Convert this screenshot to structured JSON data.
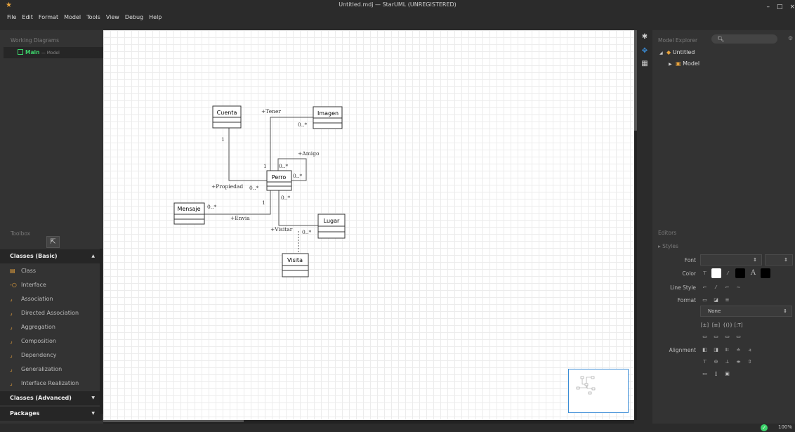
{
  "window": {
    "title": "Untitled.mdj — StarUML (UNREGISTERED)"
  },
  "menu": [
    "File",
    "Edit",
    "Format",
    "Model",
    "Tools",
    "View",
    "Debug",
    "Help"
  ],
  "working_diagrams": {
    "title": "Working Diagrams",
    "items": [
      {
        "name": "Main",
        "sub": "— Model"
      }
    ]
  },
  "toolbox": {
    "title": "Toolbox",
    "pointer": "⇱",
    "sections": [
      {
        "label": "Classes (Basic)",
        "expanded": true
      },
      {
        "label": "Classes (Advanced)",
        "expanded": false
      },
      {
        "label": "Packages",
        "expanded": false
      }
    ],
    "tools": [
      "Class",
      "Interface",
      "Association",
      "Directed Association",
      "Aggregation",
      "Composition",
      "Dependency",
      "Generalization",
      "Interface Realization"
    ]
  },
  "model_explorer": {
    "title": "Model Explorer",
    "search_placeholder": "",
    "tree": [
      {
        "label": "Untitled"
      },
      {
        "label": "Model"
      }
    ]
  },
  "editors": {
    "title": "Editors",
    "styles_label": "Styles",
    "labels": {
      "font": "Font",
      "color": "Color",
      "line_style": "Line Style",
      "format": "Format",
      "alignment": "Alignment"
    },
    "format_select": "None"
  },
  "diagram": {
    "classes": [
      "Cuenta",
      "Imagen",
      "Perro",
      "Mensaje",
      "Lugar",
      "Visita"
    ],
    "labels": {
      "tener": "+Tener",
      "tener_mult": "0..*",
      "cuenta_mult": "1",
      "amigo": "+Amigo",
      "amigo_m1": "0..*",
      "amigo_m2": "0..*",
      "perro_one_top": "1",
      "propiedad": "+Propiedad",
      "propiedad_mult": "0..*",
      "envia": "+Envia",
      "mensaje_mult": "0..*",
      "perro_one_left": "1",
      "perro_bottom_mult": "0..*",
      "visitar": "+Visitar",
      "lugar_mult": "0..*"
    }
  },
  "status": {
    "zoom": "100%"
  },
  "colors": {
    "accent_green": "#3cd26a",
    "accent_orange": "#e8a33c",
    "minimap_border": "#3a8cd6"
  }
}
